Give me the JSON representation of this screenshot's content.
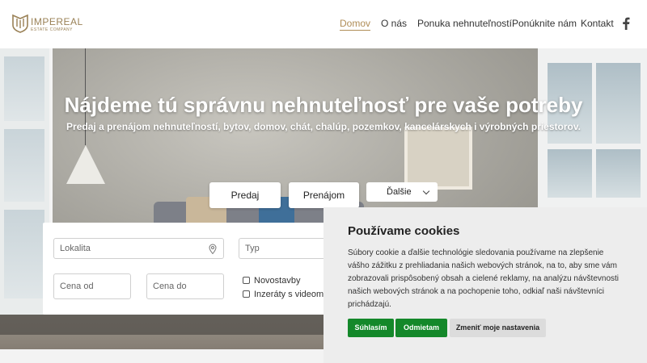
{
  "brand": {
    "name": "IMPEREAL",
    "subtitle": "ESTATE COMPANY",
    "accent": "#b08d57"
  },
  "nav": {
    "items": [
      {
        "label": "Domov",
        "active": true
      },
      {
        "label": "O nás",
        "active": false
      },
      {
        "label": "Ponuka nehnuteľností",
        "active": false
      },
      {
        "label": "Ponúknite nám",
        "active": false
      },
      {
        "label": "Kontakt",
        "active": false
      }
    ],
    "social_icon": "facebook-icon"
  },
  "hero": {
    "title": "Nájdeme tú správnu nehnuteľnosť pre vaše potreby",
    "subtitle": "Predaj a prenájom nehnuteľností, bytov, domov, chát, chalúp, pozemkov, kancelárskych i výrobných priestorov."
  },
  "tabs": {
    "sale": "Predaj",
    "rent": "Prenájom",
    "more": "Ďalšie"
  },
  "search": {
    "location_placeholder": "Lokalita",
    "type_placeholder": "Typ",
    "price_from_placeholder": "Cena od",
    "price_to_placeholder": "Cena do",
    "new_builds_label": "Novostavby",
    "video_ads_label": "Inzeráty s videom"
  },
  "cookies": {
    "title": "Používame cookies",
    "text": "Súbory cookie a ďalšie technológie sledovania používame na zlepšenie vášho zážitku z prehliadania našich webových stránok, na to, aby sme vám zobrazovali prispôsobený obsah a cielené reklamy, na analýzu návštevnosti našich webových stránok a na pochopenie toho, odkiaľ naši návštevníci prichádzajú.",
    "accept": "Súhlasím",
    "reject": "Odmietam",
    "settings": "Zmeniť moje nastavenia",
    "button_color": "#14882a"
  }
}
